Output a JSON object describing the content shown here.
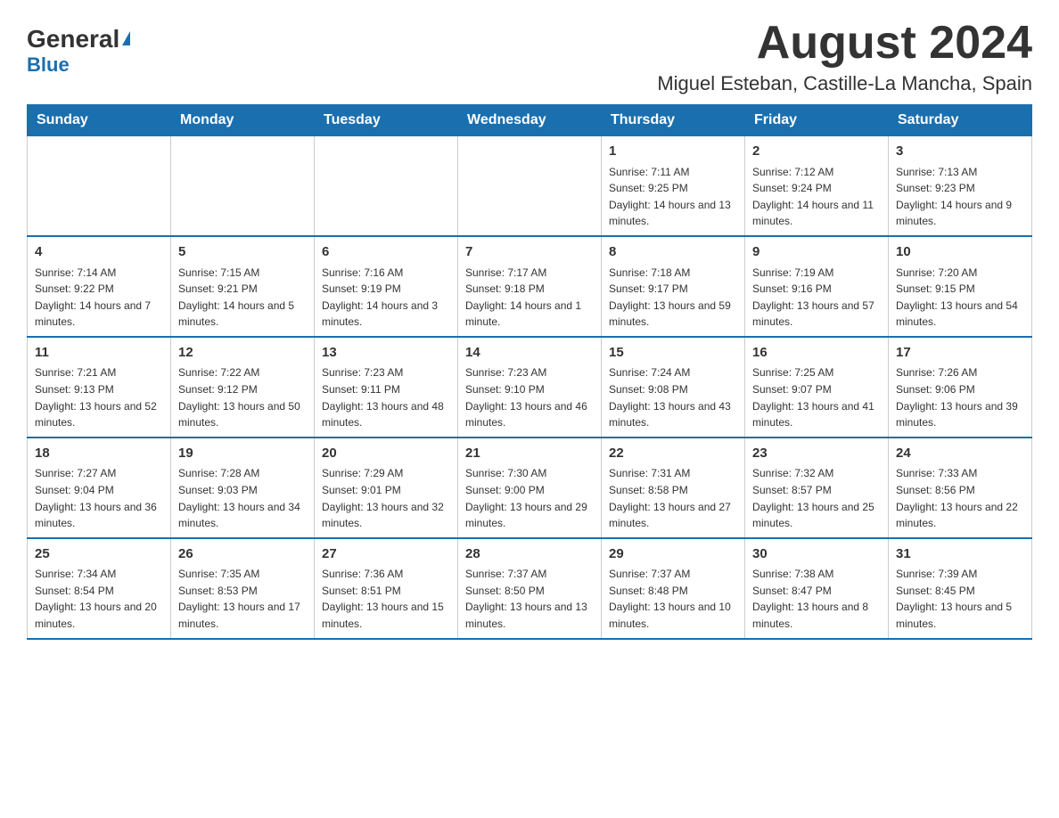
{
  "logo": {
    "general": "General",
    "blue": "Blue"
  },
  "title": "August 2024",
  "location": "Miguel Esteban, Castille-La Mancha, Spain",
  "days_of_week": [
    "Sunday",
    "Monday",
    "Tuesday",
    "Wednesday",
    "Thursday",
    "Friday",
    "Saturday"
  ],
  "weeks": [
    [
      {
        "day": "",
        "info": ""
      },
      {
        "day": "",
        "info": ""
      },
      {
        "day": "",
        "info": ""
      },
      {
        "day": "",
        "info": ""
      },
      {
        "day": "1",
        "info": "Sunrise: 7:11 AM\nSunset: 9:25 PM\nDaylight: 14 hours and 13 minutes."
      },
      {
        "day": "2",
        "info": "Sunrise: 7:12 AM\nSunset: 9:24 PM\nDaylight: 14 hours and 11 minutes."
      },
      {
        "day": "3",
        "info": "Sunrise: 7:13 AM\nSunset: 9:23 PM\nDaylight: 14 hours and 9 minutes."
      }
    ],
    [
      {
        "day": "4",
        "info": "Sunrise: 7:14 AM\nSunset: 9:22 PM\nDaylight: 14 hours and 7 minutes."
      },
      {
        "day": "5",
        "info": "Sunrise: 7:15 AM\nSunset: 9:21 PM\nDaylight: 14 hours and 5 minutes."
      },
      {
        "day": "6",
        "info": "Sunrise: 7:16 AM\nSunset: 9:19 PM\nDaylight: 14 hours and 3 minutes."
      },
      {
        "day": "7",
        "info": "Sunrise: 7:17 AM\nSunset: 9:18 PM\nDaylight: 14 hours and 1 minute."
      },
      {
        "day": "8",
        "info": "Sunrise: 7:18 AM\nSunset: 9:17 PM\nDaylight: 13 hours and 59 minutes."
      },
      {
        "day": "9",
        "info": "Sunrise: 7:19 AM\nSunset: 9:16 PM\nDaylight: 13 hours and 57 minutes."
      },
      {
        "day": "10",
        "info": "Sunrise: 7:20 AM\nSunset: 9:15 PM\nDaylight: 13 hours and 54 minutes."
      }
    ],
    [
      {
        "day": "11",
        "info": "Sunrise: 7:21 AM\nSunset: 9:13 PM\nDaylight: 13 hours and 52 minutes."
      },
      {
        "day": "12",
        "info": "Sunrise: 7:22 AM\nSunset: 9:12 PM\nDaylight: 13 hours and 50 minutes."
      },
      {
        "day": "13",
        "info": "Sunrise: 7:23 AM\nSunset: 9:11 PM\nDaylight: 13 hours and 48 minutes."
      },
      {
        "day": "14",
        "info": "Sunrise: 7:23 AM\nSunset: 9:10 PM\nDaylight: 13 hours and 46 minutes."
      },
      {
        "day": "15",
        "info": "Sunrise: 7:24 AM\nSunset: 9:08 PM\nDaylight: 13 hours and 43 minutes."
      },
      {
        "day": "16",
        "info": "Sunrise: 7:25 AM\nSunset: 9:07 PM\nDaylight: 13 hours and 41 minutes."
      },
      {
        "day": "17",
        "info": "Sunrise: 7:26 AM\nSunset: 9:06 PM\nDaylight: 13 hours and 39 minutes."
      }
    ],
    [
      {
        "day": "18",
        "info": "Sunrise: 7:27 AM\nSunset: 9:04 PM\nDaylight: 13 hours and 36 minutes."
      },
      {
        "day": "19",
        "info": "Sunrise: 7:28 AM\nSunset: 9:03 PM\nDaylight: 13 hours and 34 minutes."
      },
      {
        "day": "20",
        "info": "Sunrise: 7:29 AM\nSunset: 9:01 PM\nDaylight: 13 hours and 32 minutes."
      },
      {
        "day": "21",
        "info": "Sunrise: 7:30 AM\nSunset: 9:00 PM\nDaylight: 13 hours and 29 minutes."
      },
      {
        "day": "22",
        "info": "Sunrise: 7:31 AM\nSunset: 8:58 PM\nDaylight: 13 hours and 27 minutes."
      },
      {
        "day": "23",
        "info": "Sunrise: 7:32 AM\nSunset: 8:57 PM\nDaylight: 13 hours and 25 minutes."
      },
      {
        "day": "24",
        "info": "Sunrise: 7:33 AM\nSunset: 8:56 PM\nDaylight: 13 hours and 22 minutes."
      }
    ],
    [
      {
        "day": "25",
        "info": "Sunrise: 7:34 AM\nSunset: 8:54 PM\nDaylight: 13 hours and 20 minutes."
      },
      {
        "day": "26",
        "info": "Sunrise: 7:35 AM\nSunset: 8:53 PM\nDaylight: 13 hours and 17 minutes."
      },
      {
        "day": "27",
        "info": "Sunrise: 7:36 AM\nSunset: 8:51 PM\nDaylight: 13 hours and 15 minutes."
      },
      {
        "day": "28",
        "info": "Sunrise: 7:37 AM\nSunset: 8:50 PM\nDaylight: 13 hours and 13 minutes."
      },
      {
        "day": "29",
        "info": "Sunrise: 7:37 AM\nSunset: 8:48 PM\nDaylight: 13 hours and 10 minutes."
      },
      {
        "day": "30",
        "info": "Sunrise: 7:38 AM\nSunset: 8:47 PM\nDaylight: 13 hours and 8 minutes."
      },
      {
        "day": "31",
        "info": "Sunrise: 7:39 AM\nSunset: 8:45 PM\nDaylight: 13 hours and 5 minutes."
      }
    ]
  ]
}
